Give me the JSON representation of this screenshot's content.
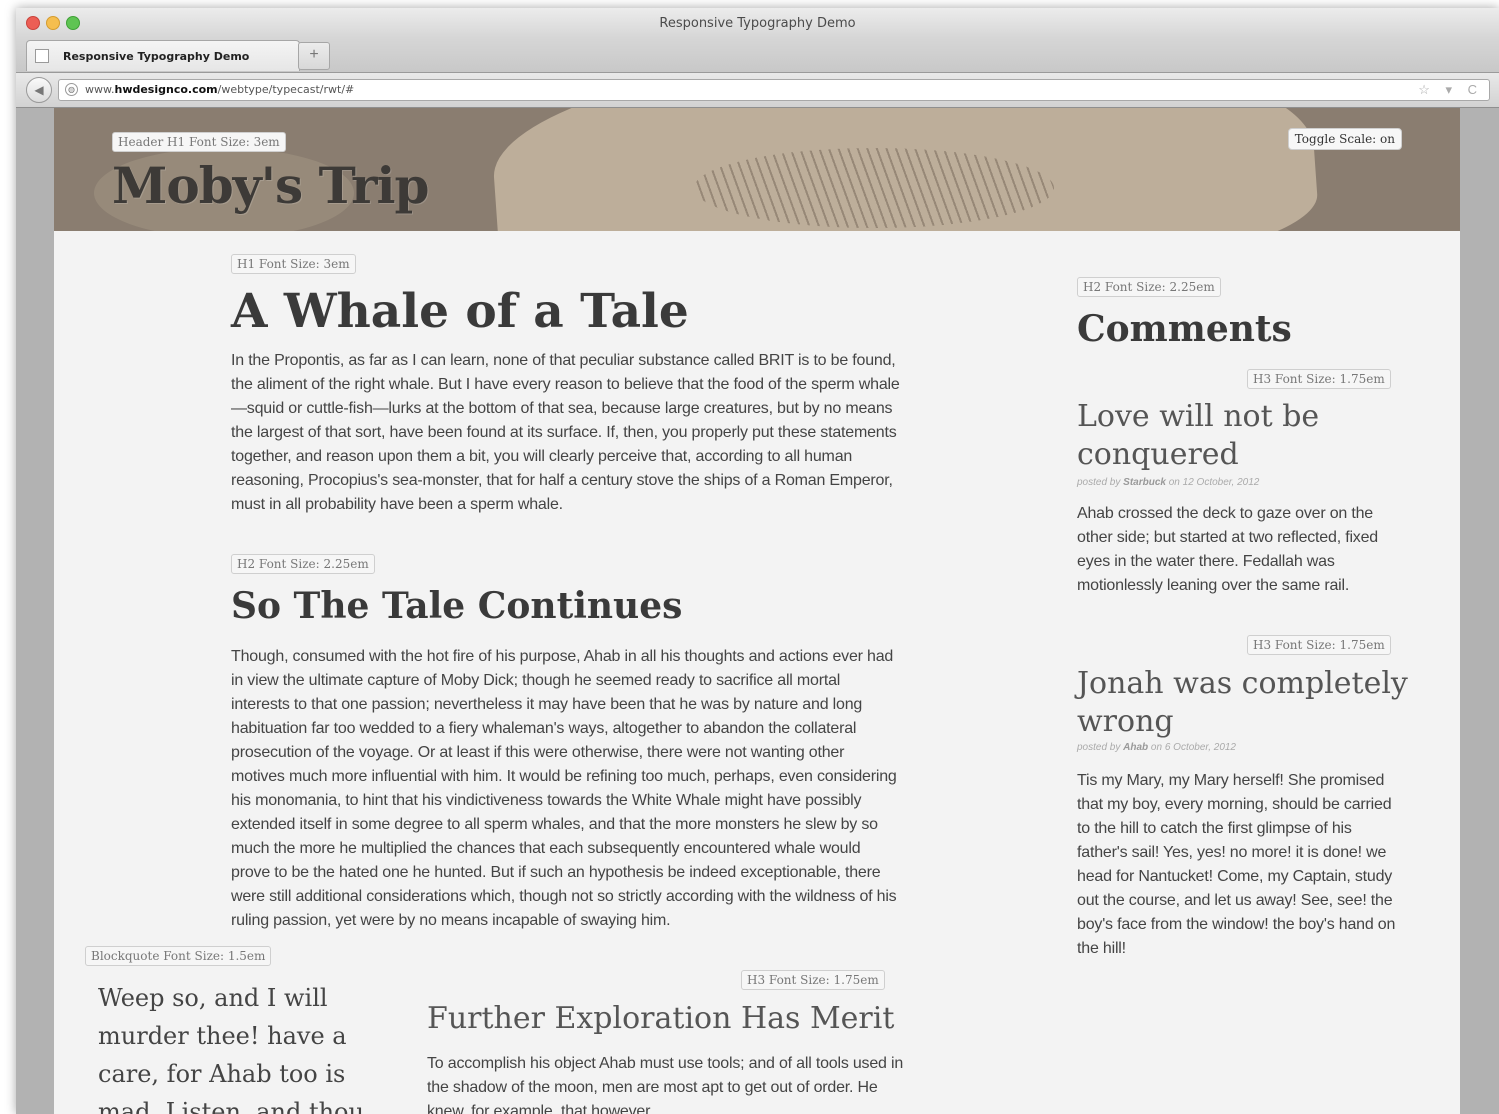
{
  "browser": {
    "window_title": "Responsive Typography Demo",
    "tab_label": "Responsive Typography Demo",
    "new_tab_symbol": "+",
    "back_symbol": "◀",
    "url_prefix": "www.",
    "url_domain": "hwdesignco.com",
    "url_path": "/webtype/typecast/rwt/#",
    "url_tools": "☆ ▾ C"
  },
  "header": {
    "tag": "Header H1 Font Size: 3em",
    "title": "Moby's Trip",
    "toggle": "Toggle Scale: on"
  },
  "article": {
    "h1_tag": "H1 Font Size: 3em",
    "h1": "A Whale of a Tale",
    "p1": "In the Propontis, as far as I can learn, none of that peculiar substance called BRIT is to be found, the aliment of the right whale. But I have every reason to believe that the food of the sperm whale—squid or cuttle-fish—lurks at the bottom of that sea, because large creatures, but by no means the largest of that sort, have been found at its surface. If, then, you properly put these statements together, and reason upon them a bit, you will clearly perceive that, according to all human reasoning, Procopius's sea-monster, that for half a century stove the ships of a Roman Emperor, must in all probability have been a sperm whale.",
    "h2_tag": "H2 Font Size: 2.25em",
    "h2": "So The Tale Continues",
    "p2": "Though, consumed with the hot fire of his purpose, Ahab in all his thoughts and actions ever had in view the ultimate capture of Moby Dick; though he seemed ready to sacrifice all mortal interests to that one passion; nevertheless it may have been that he was by nature and long habituation far too wedded to a fiery whaleman's ways, altogether to abandon the collateral prosecution of the voyage. Or at least if this were otherwise, there were not wanting other motives much more influential with him. It would be refining too much, perhaps, even considering his monomania, to hint that his vindictiveness towards the White Whale might have possibly extended itself in some degree to all sperm whales, and that the more monsters he slew by so much the more he multiplied the chances that each subsequently encountered whale would prove to be the hated one he hunted. But if such an hypothesis be indeed exceptionable, there were still additional considerations which, though not so strictly according with the wildness of his ruling passion, yet were by no means incapable of swaying him.",
    "blockquote_tag": "Blockquote Font Size: 1.5em",
    "blockquote": "Weep so, and I will murder thee! have a care, for Ahab too is mad. Listen, and thou",
    "h3_tag": "H3 Font Size: 1.75em",
    "h3": "Further Exploration Has Merit",
    "p3": "To accomplish his object Ahab must use tools; and of all tools used in the shadow of the moon, men are most apt to get out of order. He knew, for example, that however"
  },
  "sidebar": {
    "h2_tag": "H2 Font Size: 2.25em",
    "h2": "Comments",
    "comments": [
      {
        "tag": "H3 Font Size: 1.75em",
        "title": "Love will not be conquered",
        "meta_prefix": "posted by ",
        "author": "Starbuck",
        "meta_suffix": " on 12 October, 2012",
        "body": "Ahab crossed the deck to gaze over on the other side; but started at two reflected, fixed eyes in the water there. Fedallah was motionlessly leaning over the same rail."
      },
      {
        "tag": "H3 Font Size: 1.75em",
        "title": "Jonah was completely wrong",
        "meta_prefix": "posted by ",
        "author": "Ahab",
        "meta_suffix": " on 6 October, 2012",
        "body": "Tis my Mary, my Mary herself! She promised that my boy, every morning, should be carried to the hill to catch the first glimpse of his father's sail! Yes, yes! no more! it is done! we head for Nantucket! Come, my Captain, study out the course, and let us away! See, see! the boy's face from the window! the boy's hand on the hill!"
      }
    ]
  }
}
